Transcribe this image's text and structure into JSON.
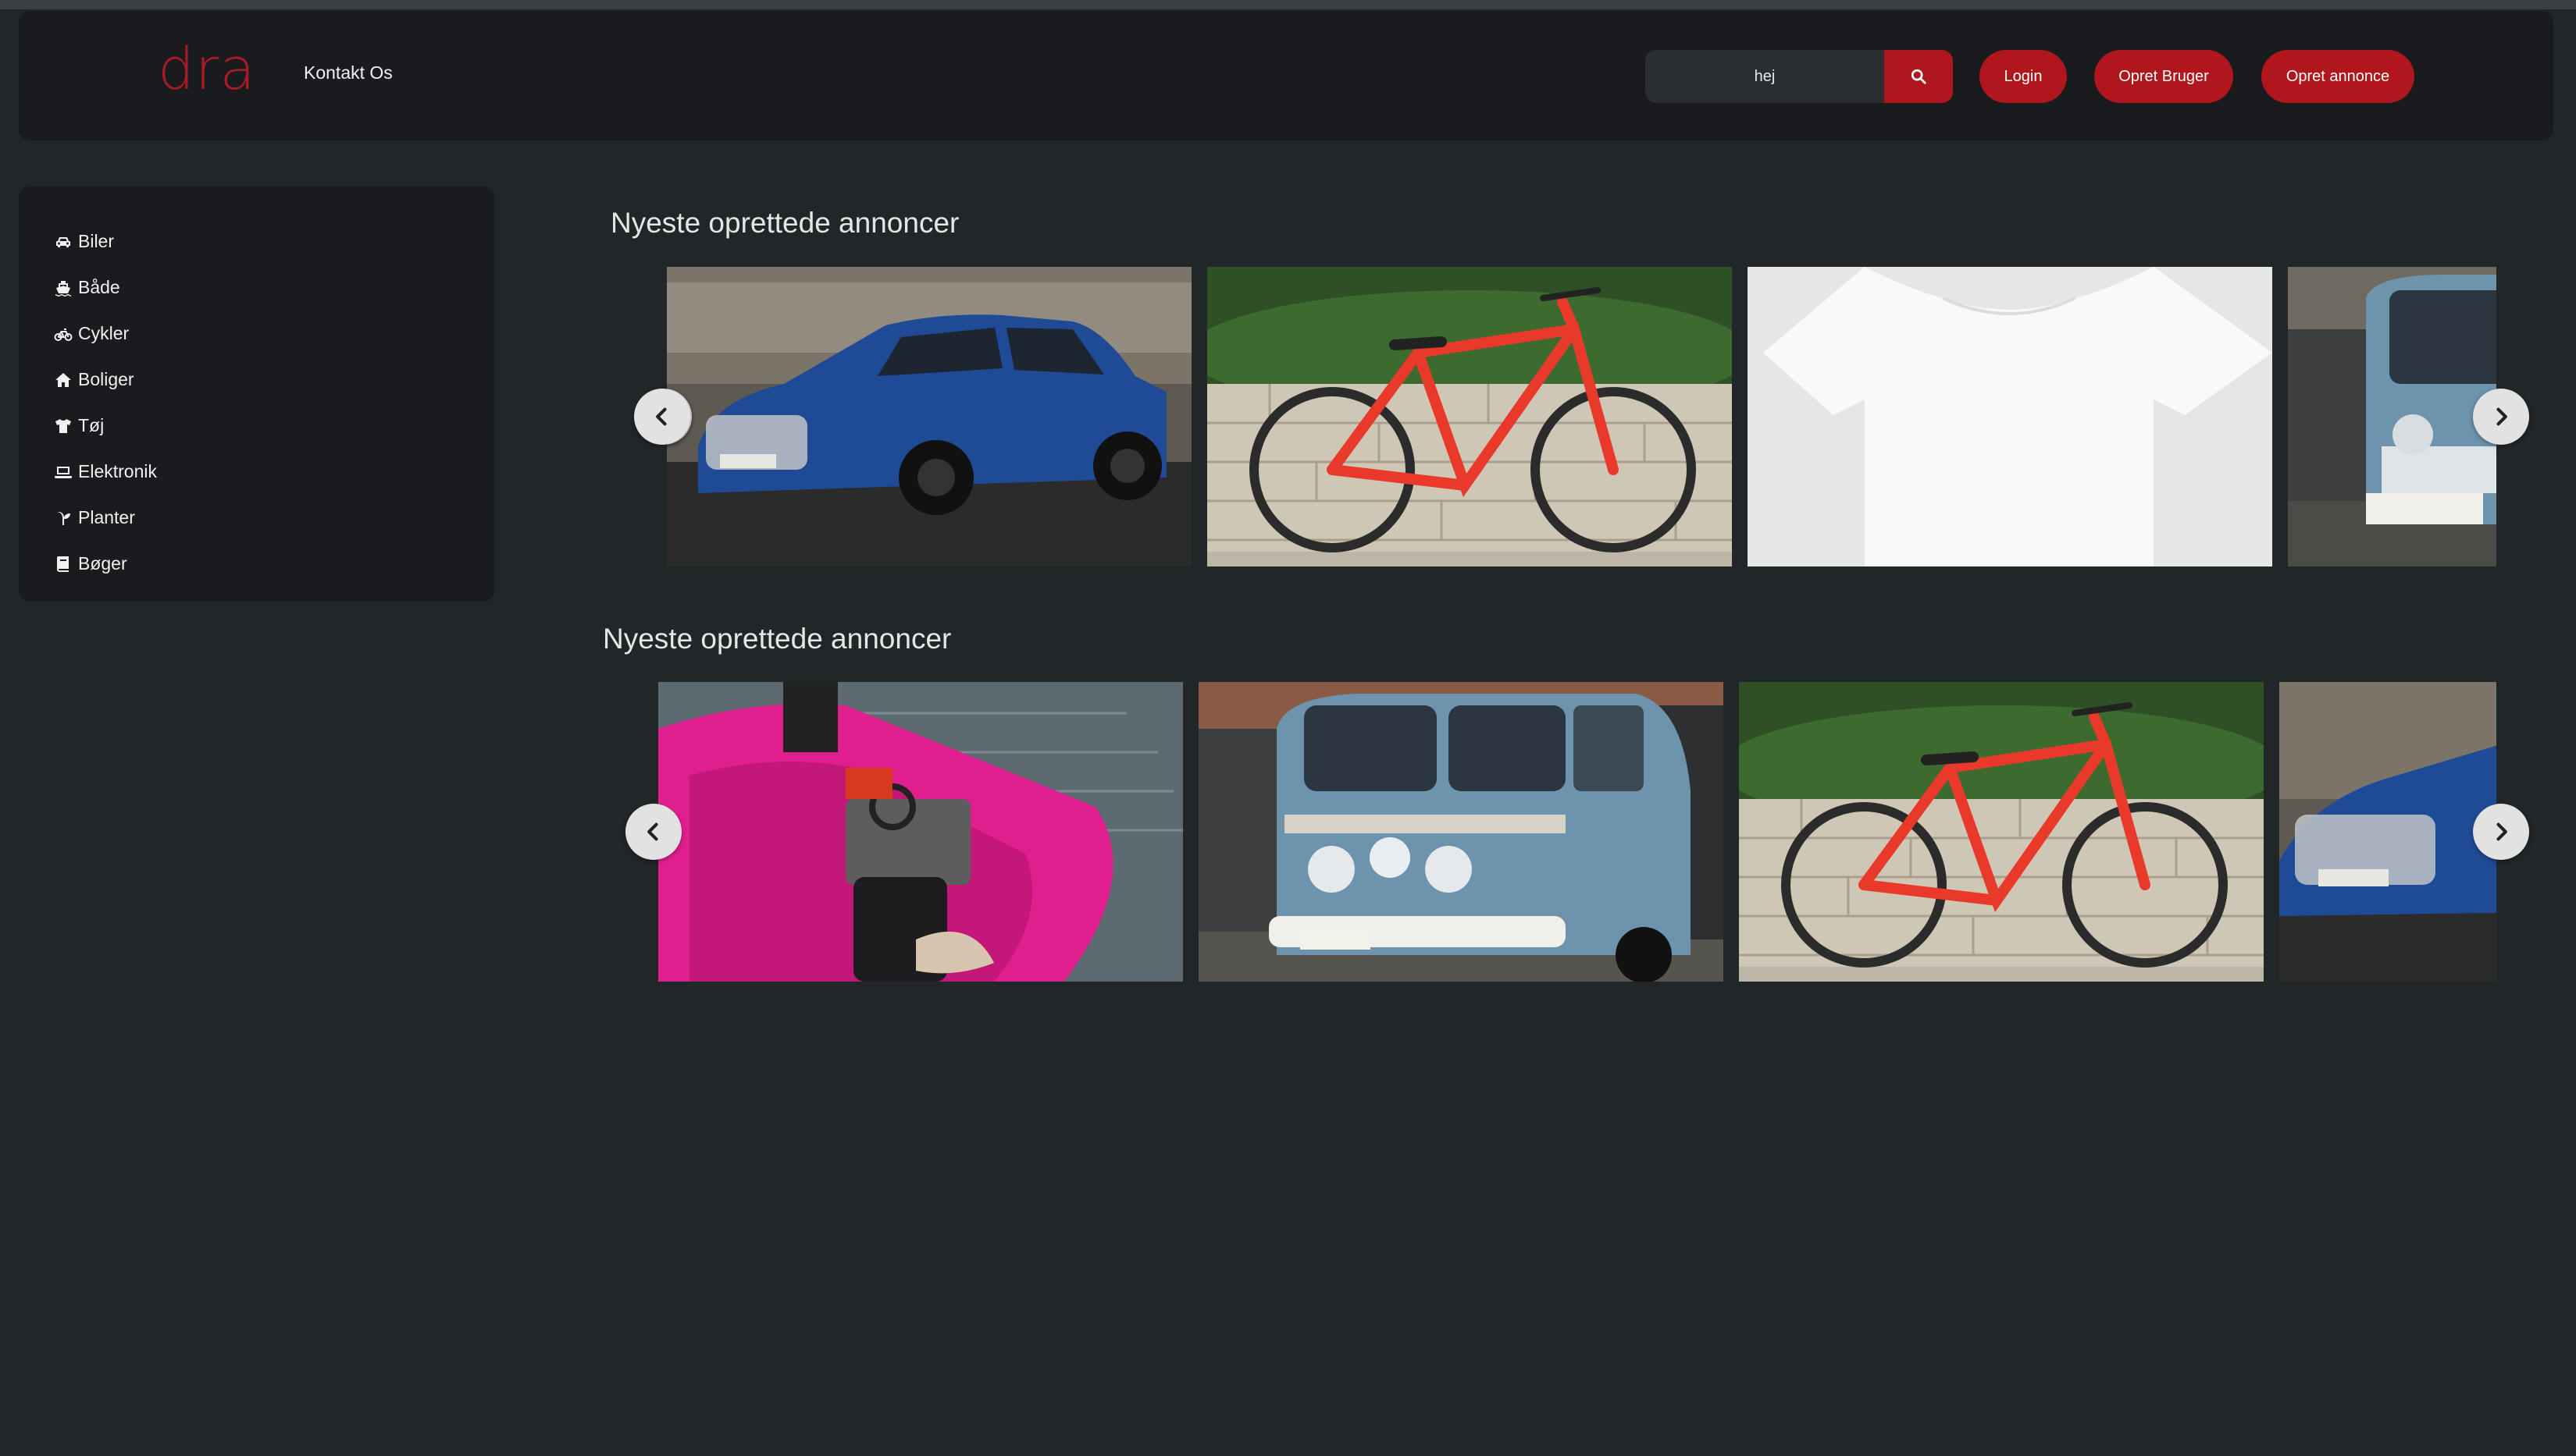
{
  "header": {
    "logo": "dra",
    "contact_link": "Kontakt Os",
    "search": {
      "value": "hej",
      "placeholder": ""
    },
    "login_label": "Login",
    "signup_label": "Opret Bruger",
    "create_ad_label": "Opret annonce"
  },
  "sidebar": {
    "items": [
      {
        "label": "Biler",
        "icon": "car-icon"
      },
      {
        "label": "Både",
        "icon": "ship-icon"
      },
      {
        "label": "Cykler",
        "icon": "bicycle-icon"
      },
      {
        "label": "Boliger",
        "icon": "house-icon"
      },
      {
        "label": "Tøj",
        "icon": "shirt-icon"
      },
      {
        "label": "Elektronik",
        "icon": "laptop-icon"
      },
      {
        "label": "Planter",
        "icon": "seedling-icon"
      },
      {
        "label": "Bøger",
        "icon": "book-icon"
      }
    ]
  },
  "sections": [
    {
      "title": "Nyeste oprettede annoncer",
      "slides": [
        "blue-suv-image",
        "red-bicycle-image",
        "white-tshirt-image",
        "blue-van-image"
      ]
    },
    {
      "title": "Nyeste oprettede annoncer",
      "slides": [
        "pink-boat-image",
        "blue-van-image",
        "red-bicycle-image",
        "blue-suv-image"
      ]
    }
  ],
  "colors": {
    "background": "#212629",
    "panel": "#191b1e",
    "accent": "#b0171d",
    "logo": "#a91b22"
  }
}
